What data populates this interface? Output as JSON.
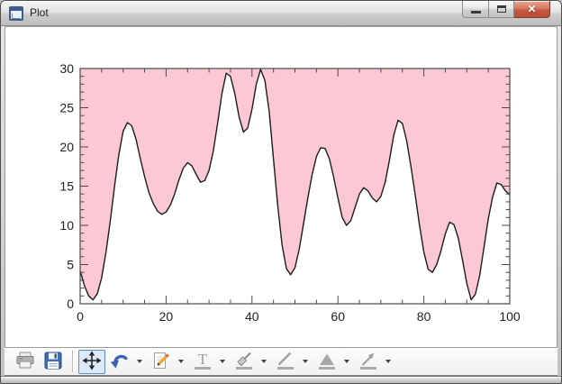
{
  "window": {
    "title": "Plot",
    "controls": [
      {
        "name": "minimize-button",
        "icon": "minimize-icon"
      },
      {
        "name": "maximize-button",
        "icon": "maximize-icon"
      },
      {
        "name": "close-button",
        "icon": "close-icon",
        "glyph": "✕",
        "color": "#c2563c"
      }
    ]
  },
  "toolbar": {
    "items": [
      {
        "name": "print",
        "icon": "print-icon",
        "enabled": true,
        "active": false,
        "dropdown": false
      },
      {
        "name": "save",
        "icon": "save-icon",
        "enabled": true,
        "active": false,
        "dropdown": false
      },
      {
        "type": "separator"
      },
      {
        "name": "pan",
        "icon": "pan-arrows-icon",
        "enabled": true,
        "active": true,
        "dropdown": false
      },
      {
        "name": "undo",
        "icon": "undo-icon",
        "enabled": true,
        "active": false,
        "dropdown": true
      },
      {
        "name": "annotate",
        "icon": "pencil-icon",
        "enabled": true,
        "active": false,
        "dropdown": true
      },
      {
        "name": "text",
        "icon": "text-icon",
        "enabled": false,
        "active": false,
        "dropdown": true
      },
      {
        "name": "freehand",
        "icon": "brush-icon",
        "enabled": false,
        "active": false,
        "dropdown": true
      },
      {
        "name": "line",
        "icon": "line-icon",
        "enabled": false,
        "active": false,
        "dropdown": true
      },
      {
        "name": "polygon",
        "icon": "polygon-icon",
        "enabled": false,
        "active": false,
        "dropdown": true
      },
      {
        "name": "arrow",
        "icon": "arrow-icon",
        "enabled": false,
        "active": false,
        "dropdown": true
      }
    ]
  },
  "chart_data": {
    "type": "area",
    "title": "",
    "xlabel": "",
    "ylabel": "",
    "xlim": [
      0,
      100
    ],
    "ylim": [
      0,
      30
    ],
    "xticks": [
      0,
      20,
      40,
      60,
      80,
      100
    ],
    "yticks": [
      0,
      5,
      10,
      15,
      20,
      25,
      30
    ],
    "x_minor_step": 5,
    "y_minor_step": 1,
    "grid": false,
    "frame": "box",
    "fill_side": "above",
    "fill_color": "#FBC8D4",
    "line_color": "#1c1c1c",
    "axis_color": "#4a4a4a",
    "label_color": "#1e1e1e",
    "x": [
      0,
      1,
      2,
      3,
      4,
      5,
      6,
      7,
      8,
      9,
      10,
      11,
      12,
      13,
      14,
      15,
      16,
      17,
      18,
      19,
      20,
      21,
      22,
      23,
      24,
      25,
      26,
      27,
      28,
      29,
      30,
      31,
      32,
      33,
      34,
      35,
      36,
      37,
      38,
      39,
      40,
      41,
      42,
      43,
      44,
      45,
      46,
      47,
      48,
      49,
      50,
      51,
      52,
      53,
      54,
      55,
      56,
      57,
      58,
      59,
      60,
      61,
      62,
      63,
      64,
      65,
      66,
      67,
      68,
      69,
      70,
      71,
      72,
      73,
      74,
      75,
      76,
      77,
      78,
      79,
      80,
      81,
      82,
      83,
      84,
      85,
      86,
      87,
      88,
      89,
      90,
      91,
      92,
      93,
      94,
      95,
      96,
      97,
      98,
      99,
      100
    ],
    "values": [
      4.2,
      2.3,
      1.0,
      0.5,
      1.3,
      3.3,
      6.5,
      10.5,
      15.0,
      19.0,
      22.0,
      23.1,
      22.7,
      21.0,
      18.5,
      16.2,
      14.2,
      12.8,
      11.8,
      11.4,
      11.7,
      12.6,
      14.0,
      15.8,
      17.3,
      18.0,
      17.6,
      16.5,
      15.5,
      15.7,
      17.0,
      19.5,
      23.0,
      26.8,
      29.4,
      29.0,
      26.8,
      23.8,
      21.9,
      22.4,
      24.8,
      28.0,
      29.9,
      28.5,
      24.5,
      18.5,
      12.5,
      7.5,
      4.5,
      3.7,
      4.6,
      7.0,
      10.2,
      13.5,
      16.5,
      18.8,
      19.9,
      19.8,
      18.5,
      16.2,
      13.5,
      11.0,
      10.0,
      10.6,
      12.3,
      14.0,
      14.8,
      14.4,
      13.5,
      13.0,
      13.7,
      15.5,
      18.3,
      21.5,
      23.4,
      23.0,
      20.8,
      17.5,
      13.8,
      10.0,
      6.6,
      4.4,
      4.0,
      5.0,
      6.8,
      8.9,
      10.4,
      10.1,
      8.4,
      5.6,
      2.6,
      0.5,
      1.2,
      3.6,
      7.2,
      10.8,
      13.6,
      15.4,
      15.2,
      14.4,
      13.9
    ]
  }
}
